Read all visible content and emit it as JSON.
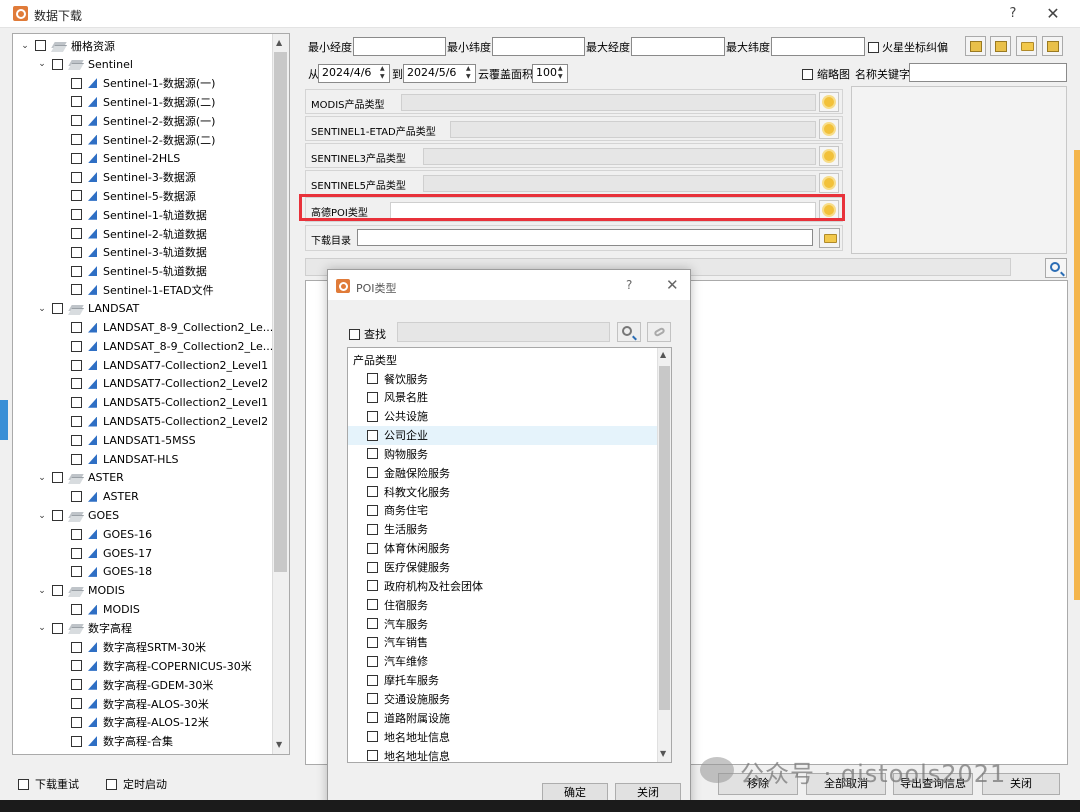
{
  "window": {
    "title": "数据下载",
    "help": "?",
    "close": "✕"
  },
  "tree": {
    "items": [
      {
        "label": "栅格资源",
        "level": 0,
        "icon": "layers",
        "expanded": true
      },
      {
        "label": "Sentinel",
        "level": 1,
        "icon": "layers",
        "expanded": true
      },
      {
        "label": "Sentinel-1-数据源(一)",
        "level": 2,
        "icon": "raster"
      },
      {
        "label": "Sentinel-1-数据源(二)",
        "level": 2,
        "icon": "raster"
      },
      {
        "label": "Sentinel-2-数据源(一)",
        "level": 2,
        "icon": "raster"
      },
      {
        "label": "Sentinel-2-数据源(二)",
        "level": 2,
        "icon": "raster"
      },
      {
        "label": "Sentinel-2HLS",
        "level": 2,
        "icon": "raster"
      },
      {
        "label": "Sentinel-3-数据源",
        "level": 2,
        "icon": "raster"
      },
      {
        "label": "Sentinel-5-数据源",
        "level": 2,
        "icon": "raster"
      },
      {
        "label": "Sentinel-1-轨道数据",
        "level": 2,
        "icon": "raster"
      },
      {
        "label": "Sentinel-2-轨道数据",
        "level": 2,
        "icon": "raster"
      },
      {
        "label": "Sentinel-3-轨道数据",
        "level": 2,
        "icon": "raster"
      },
      {
        "label": "Sentinel-5-轨道数据",
        "level": 2,
        "icon": "raster"
      },
      {
        "label": "Sentinel-1-ETAD文件",
        "level": 2,
        "icon": "raster"
      },
      {
        "label": "LANDSAT",
        "level": 1,
        "icon": "layers",
        "expanded": true
      },
      {
        "label": "LANDSAT_8-9_Collection2_Le...",
        "level": 2,
        "icon": "raster"
      },
      {
        "label": "LANDSAT_8-9_Collection2_Le...",
        "level": 2,
        "icon": "raster"
      },
      {
        "label": "LANDSAT7-Collection2_Level1",
        "level": 2,
        "icon": "raster"
      },
      {
        "label": "LANDSAT7-Collection2_Level2",
        "level": 2,
        "icon": "raster"
      },
      {
        "label": "LANDSAT5-Collection2_Level1",
        "level": 2,
        "icon": "raster"
      },
      {
        "label": "LANDSAT5-Collection2_Level2",
        "level": 2,
        "icon": "raster"
      },
      {
        "label": "LANDSAT1-5MSS",
        "level": 2,
        "icon": "raster"
      },
      {
        "label": "LANDSAT-HLS",
        "level": 2,
        "icon": "raster"
      },
      {
        "label": "ASTER",
        "level": 1,
        "icon": "layers",
        "expanded": true
      },
      {
        "label": "ASTER",
        "level": 2,
        "icon": "raster"
      },
      {
        "label": "GOES",
        "level": 1,
        "icon": "layers",
        "expanded": true
      },
      {
        "label": "GOES-16",
        "level": 2,
        "icon": "raster"
      },
      {
        "label": "GOES-17",
        "level": 2,
        "icon": "raster"
      },
      {
        "label": "GOES-18",
        "level": 2,
        "icon": "raster"
      },
      {
        "label": "MODIS",
        "level": 1,
        "icon": "layers",
        "expanded": true
      },
      {
        "label": "MODIS",
        "level": 2,
        "icon": "raster"
      },
      {
        "label": "数字高程",
        "level": 1,
        "icon": "layers",
        "expanded": true
      },
      {
        "label": "数字高程SRTM-30米",
        "level": 2,
        "icon": "raster"
      },
      {
        "label": "数字高程-COPERNICUS-30米",
        "level": 2,
        "icon": "raster"
      },
      {
        "label": "数字高程-GDEM-30米",
        "level": 2,
        "icon": "raster"
      },
      {
        "label": "数字高程-ALOS-30米",
        "level": 2,
        "icon": "raster"
      },
      {
        "label": "数字高程-ALOS-12米",
        "level": 2,
        "icon": "raster"
      },
      {
        "label": "数字高程-合集",
        "level": 2,
        "icon": "raster"
      }
    ]
  },
  "bottom_left": {
    "retry_label": "下载重试",
    "timer_label": "定时启动"
  },
  "params": {
    "min_lon_label": "最小经度",
    "min_lat_label": "最小纬度",
    "max_lon_label": "最大经度",
    "max_lat_label": "最大纬度",
    "mars_label": "火星坐标纠偏",
    "from_label": "从",
    "from_date": "2024/4/6",
    "to_label": "到",
    "to_date": "2024/5/6",
    "cloud_label": "云覆盖面积",
    "cloud_value": "100",
    "thumb_label": "缩略图",
    "name_kw_label": "名称关键字"
  },
  "products": [
    {
      "label": "MODIS产品类型"
    },
    {
      "label": "SENTINEL1-ETAD产品类型"
    },
    {
      "label": "SENTINEL3产品类型"
    },
    {
      "label": "SENTINEL5产品类型"
    },
    {
      "label": "高德POI类型"
    }
  ],
  "download_dir_label": "下载目录",
  "bottom_buttons": {
    "remove": "移除",
    "cancel_all": "全部取消",
    "export": "导出查询信息",
    "close": "关闭"
  },
  "watermark": "公众号 · gistools2021",
  "dialog": {
    "title": "POI类型",
    "help": "?",
    "close": "✕",
    "search_label": "查找",
    "list_header": "产品类型",
    "items": [
      "餐饮服务",
      "风景名胜",
      "公共设施",
      "公司企业",
      "购物服务",
      "金融保险服务",
      "科教文化服务",
      "商务住宅",
      "生活服务",
      "体育休闲服务",
      "医疗保健服务",
      "政府机构及社会团体",
      "住宿服务",
      "汽车服务",
      "汽车销售",
      "汽车维修",
      "摩托车服务",
      "交通设施服务",
      "道路附属设施",
      "地名地址信息",
      "地名地址信息"
    ],
    "selected_index": 3,
    "ok": "确定",
    "close_btn": "关闭"
  },
  "colors": {
    "highlight": "#e8313a",
    "accent": "#2b6db5"
  }
}
